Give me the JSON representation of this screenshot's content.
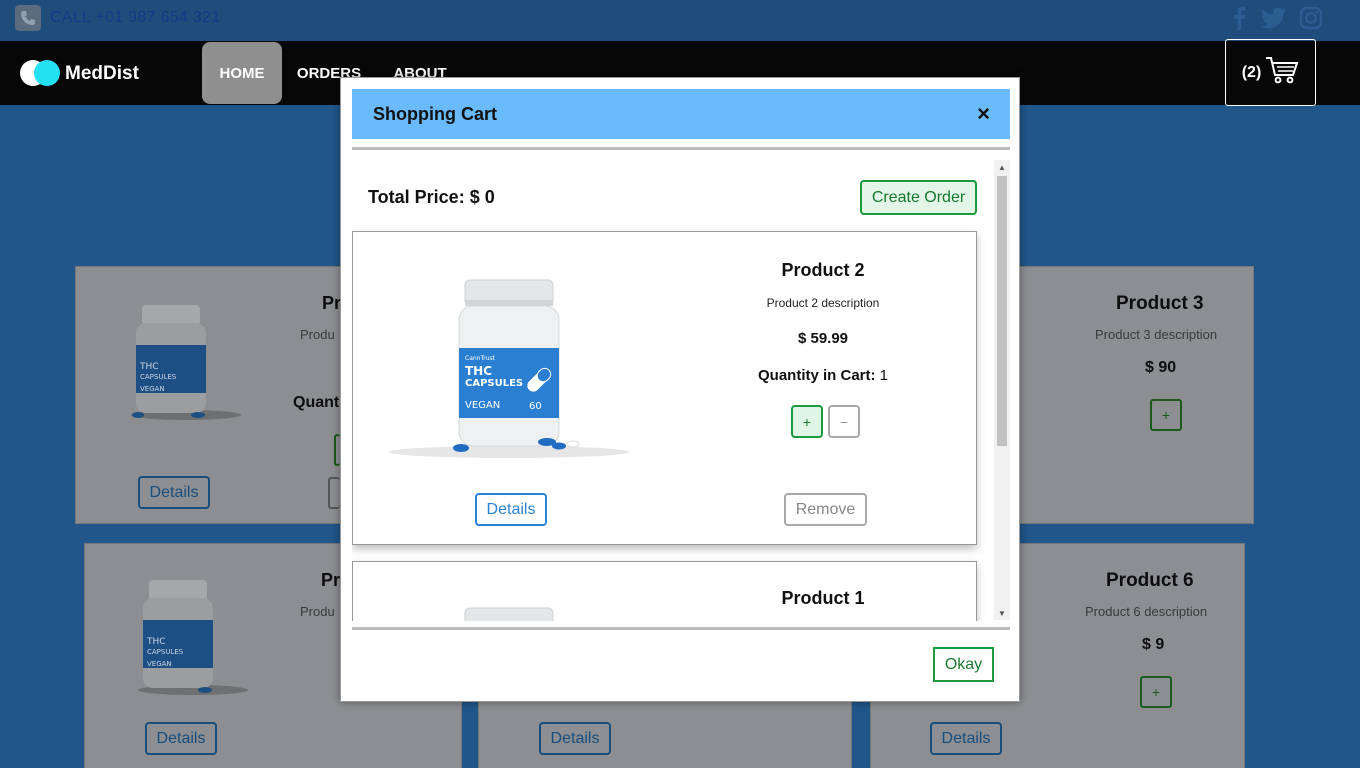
{
  "topbar": {
    "call_text": "CALL +01 987 654 321",
    "phone_icon": "phone-icon",
    "social": [
      "facebook-icon",
      "twitter-icon",
      "instagram-icon"
    ]
  },
  "nav": {
    "brand": "MedDist",
    "items": [
      {
        "label": "HOME",
        "active": true
      },
      {
        "label": "ORDERS",
        "active": false
      },
      {
        "label": "ABOUT",
        "active": false
      }
    ],
    "cart_count": "(2)",
    "cart_icon": "shopping-cart-icon"
  },
  "background_products": [
    {
      "name": "Product 3",
      "description": "Product 3 description",
      "price": "$ 90",
      "add": "+",
      "details": "Details"
    },
    {
      "name": "Product 6",
      "description": "Product 6 description",
      "price": "$ 9",
      "add": "+",
      "details": "Details"
    },
    {
      "partial_name": "Pr",
      "partial_desc": "Produ",
      "partial_qty": "Quant",
      "details": "Details"
    },
    {
      "partial_name": "Pr",
      "partial_desc": "Produ",
      "details": "Details"
    },
    {
      "details": "Details"
    }
  ],
  "modal": {
    "title": "Shopping Cart",
    "close": "×",
    "total_label": "Total Price: $ 0",
    "create_order": "Create Order",
    "okay": "Okay",
    "items": [
      {
        "name": "Product 2",
        "description": "Product 2 description",
        "price": "$ 59.99",
        "qty_label": "Quantity in Cart:",
        "qty": "1",
        "plus": "+",
        "minus": "−",
        "details": "Details",
        "remove": "Remove"
      },
      {
        "name": "Product 1"
      }
    ]
  },
  "product_image": {
    "brand": "CannTrust",
    "line1": "THC",
    "line2": "CAPSULES",
    "tag": "VEGAN",
    "count": "60"
  },
  "colors": {
    "modal_header": "#69baff",
    "nav_bg": "#070707",
    "accent_green": "#1c9a3e",
    "accent_blue": "#2c82d4",
    "logo_cyan": "#23e0f2",
    "page_bg": "#21568a"
  }
}
